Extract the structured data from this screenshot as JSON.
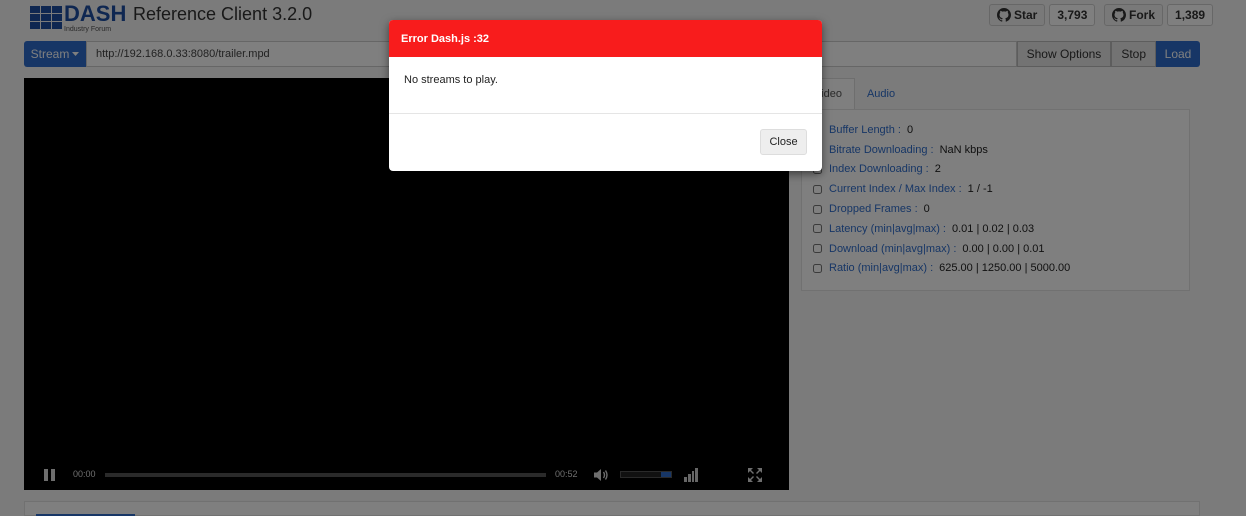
{
  "header": {
    "logo_main": "DASH",
    "logo_sub": "Industry Forum",
    "app_title": "Reference Client 3.2.0",
    "star_label": "Star",
    "star_count": "3,793",
    "fork_label": "Fork",
    "fork_count": "1,389"
  },
  "urlbar": {
    "stream_label": "Stream",
    "url_value": "http://192.168.0.33:8080/trailer.mpd",
    "show_options_label": "Show Options",
    "stop_label": "Stop",
    "load_label": "Load"
  },
  "player": {
    "current_time": "00:00",
    "duration": "00:52",
    "volume_level": 0.2
  },
  "tabs": [
    {
      "label": "Video",
      "active": true
    },
    {
      "label": "Audio",
      "active": false
    }
  ],
  "stats": [
    {
      "label": "Buffer Length :",
      "value": "0"
    },
    {
      "label": "Bitrate Downloading :",
      "value": "NaN kbps"
    },
    {
      "label": "Index Downloading :",
      "value": "2"
    },
    {
      "label": "Current Index / Max Index :",
      "value": "1 / -1"
    },
    {
      "label": "Dropped Frames :",
      "value": "0"
    },
    {
      "label": "Latency (min|avg|max) :",
      "value": "0.01 | 0.02 | 0.03"
    },
    {
      "label": "Download (min|avg|max) :",
      "value": "0.00 | 0.00 | 0.01"
    },
    {
      "label": "Ratio (min|avg|max) :",
      "value": "625.00 | 1250.00 | 5000.00"
    }
  ],
  "modal": {
    "title": "Error Dash.js :32",
    "message": "No streams to play.",
    "close_label": "Close",
    "header_color": "#f81c1c"
  },
  "colors": {
    "accent": "#2e6dcc",
    "logo_blue": "#1e4fa3"
  },
  "icons": {
    "github": "github-icon",
    "caret": "caret-down-icon",
    "pause": "pause-icon",
    "volume": "volume-icon",
    "bitrate": "bitrate-icon",
    "fullscreen": "fullscreen-icon"
  }
}
